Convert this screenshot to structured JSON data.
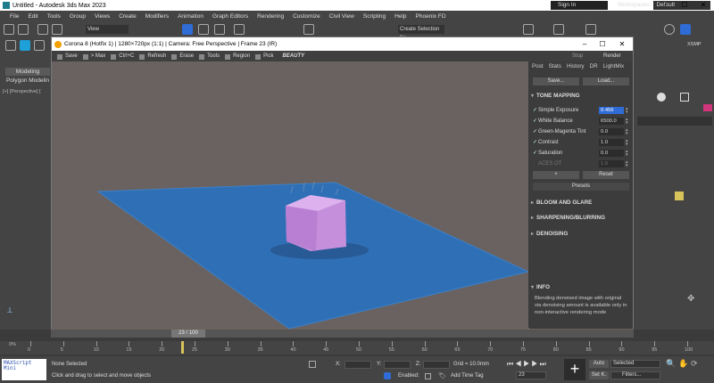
{
  "app": {
    "title": "Untitled - Autodesk 3ds Max 2023",
    "menu": [
      "File",
      "Edit",
      "Tools",
      "Group",
      "Views",
      "Create",
      "Modifiers",
      "Animation",
      "Graph Editors",
      "Rendering",
      "Customize",
      "Civil View",
      "Scripting",
      "Help",
      "Phoenix FD"
    ],
    "sign_in": "Sign In",
    "workspace_label": "Workspaces:",
    "workspace_value": "Default",
    "view_dropdown": "View",
    "selection_set": "Create Selection Se",
    "xsmp": "XSMP"
  },
  "left": {
    "modeling_tab": "Modeling",
    "polygon_label": "Polygon Modelin",
    "viewport_label": "[+] [Perspective] ["
  },
  "render_window": {
    "title": "Corona 8 (Hotfix 1) | 1280×720px (1:1) | Camera: Free Perspective | Frame 23 (IR)",
    "tools": [
      "Save",
      "> Max",
      "Ctrl+C",
      "Refresh",
      "Erase",
      "Tools",
      "Region",
      "Pick"
    ],
    "channel": "BEAUTY",
    "stop": "Stop",
    "render": "Render"
  },
  "tone_panel": {
    "tabs": [
      "Post",
      "Stats",
      "History",
      "DR",
      "LightMix"
    ],
    "save": "Save...",
    "load": "Load...",
    "section_tone": "TONE MAPPING",
    "rows": [
      {
        "label": "Simple Exposure",
        "value": "0.456",
        "checked": true
      },
      {
        "label": "White Balance",
        "value": "6500.0",
        "checked": true
      },
      {
        "label": "Green-Magenta Tint",
        "value": "0.0",
        "checked": true
      },
      {
        "label": "Contrast",
        "value": "1.0",
        "checked": true
      },
      {
        "label": "Saturation",
        "value": "0.0",
        "checked": true
      },
      {
        "label": "ACES OT",
        "value": "1.0",
        "checked": false
      }
    ],
    "add": "+",
    "reset": "Reset",
    "presets": "Presets",
    "section_bloom": "BLOOM AND GLARE",
    "section_sharp": "SHARPENING/BLURRING",
    "section_denoise": "DENOISING",
    "section_info": "INFO",
    "info_text": "Blending denoised image with original via denoising amount is available only in non-interactive rendering mode"
  },
  "timeline": {
    "frame_display": "23 / 100",
    "current_frame": 23,
    "total_frames": 100,
    "ticks": [
      "0",
      "5",
      "10",
      "15",
      "20",
      "25",
      "30",
      "35",
      "40",
      "45",
      "50",
      "55",
      "60",
      "65",
      "70",
      "75",
      "80",
      "85",
      "90",
      "95",
      "100"
    ],
    "start_pct": "0%"
  },
  "status": {
    "maxscript": "MAXScript Mini",
    "selection": "None Selected",
    "hint": "Click and drag to select and move objects",
    "x_label": "X:",
    "y_label": "Y:",
    "z_label": "Z:",
    "grid": "Grid = 10.0mm",
    "enabled": "Enabled:",
    "add_time_tag": "Add Time Tag",
    "frame_field": "23",
    "auto": "Auto",
    "selected": "Selected",
    "set_k": "Set K.",
    "filters": "Filters..."
  },
  "colors": {
    "plane": "#2f6fb5",
    "box": "#c58fdc",
    "accent": "#2f6cd6"
  }
}
